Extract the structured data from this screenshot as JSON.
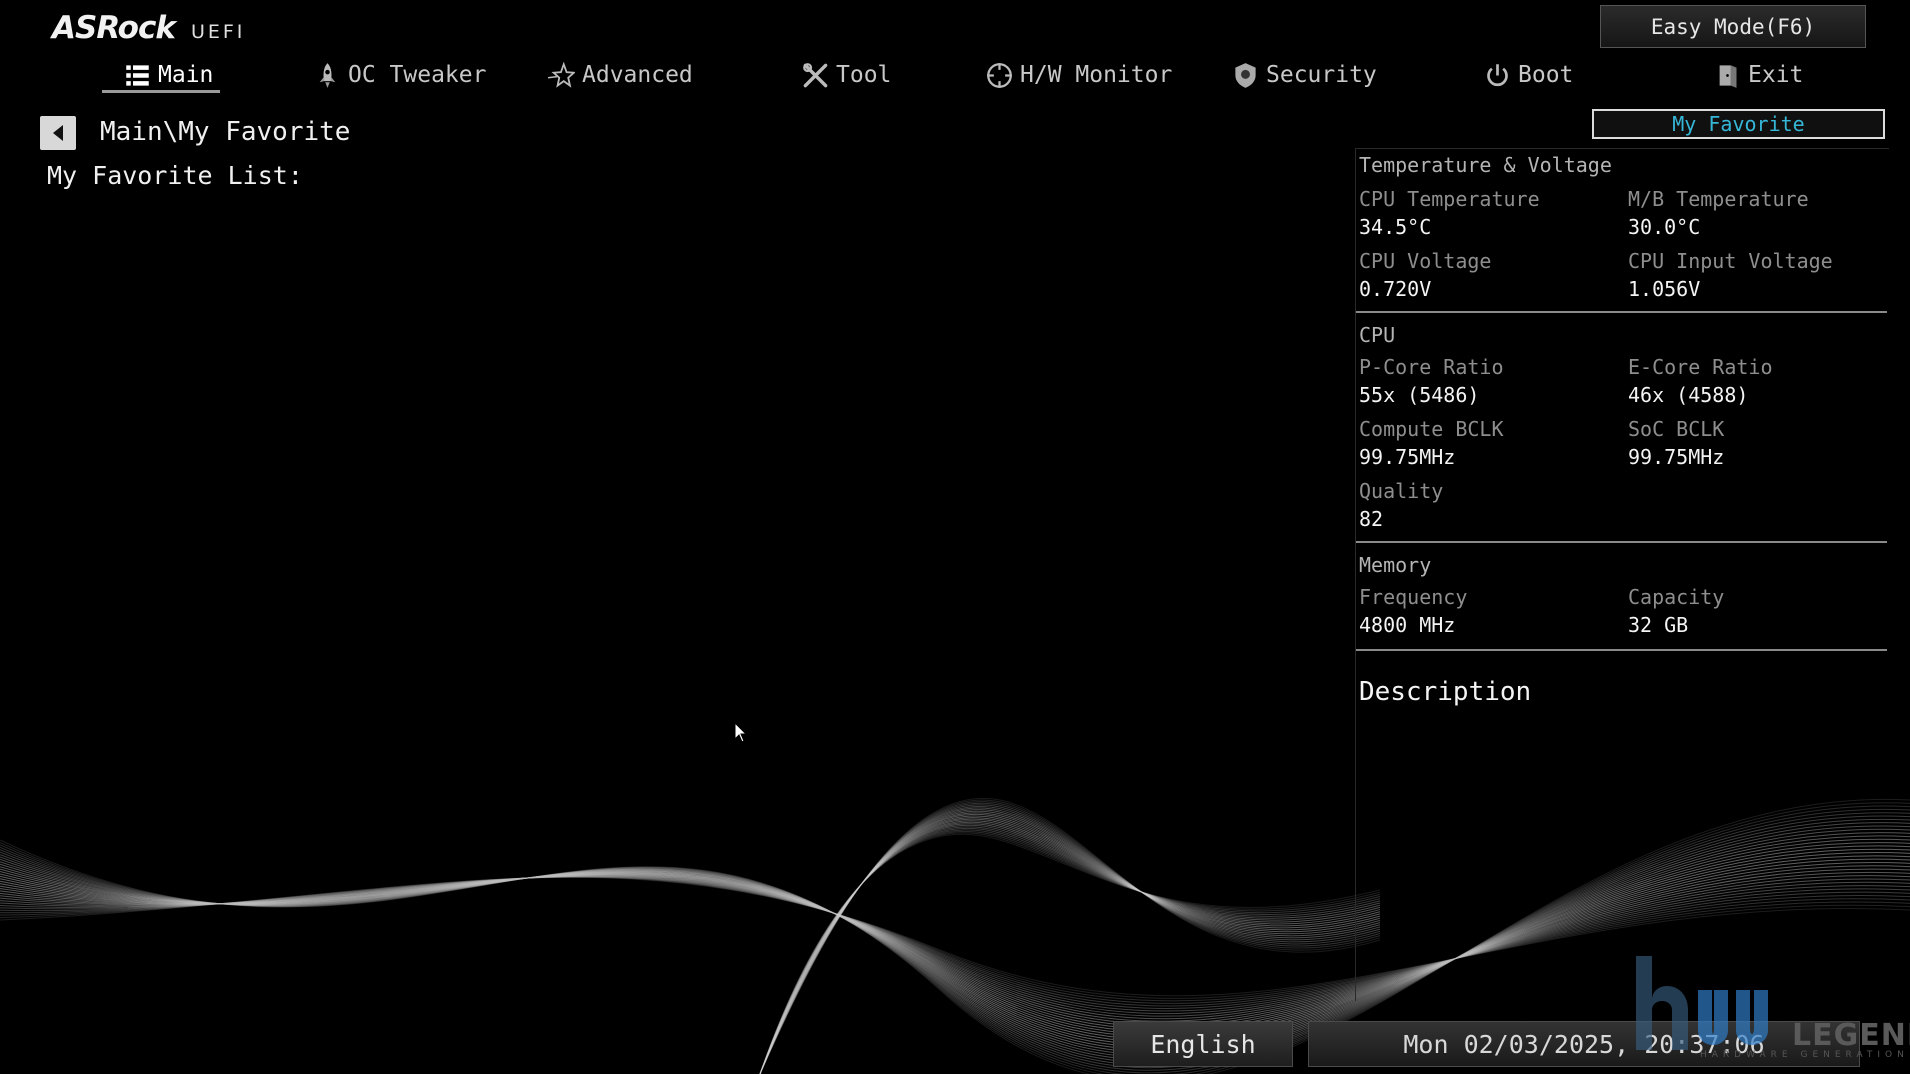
{
  "header": {
    "brand": "ASRock",
    "uefi": "UEFI",
    "easy_mode_label": "Easy Mode(F6)"
  },
  "tabs": [
    {
      "label": "Main",
      "icon": "list-icon",
      "active": true
    },
    {
      "label": "OC Tweaker",
      "icon": "rocket-icon"
    },
    {
      "label": "Advanced",
      "icon": "star-icon"
    },
    {
      "label": "Tool",
      "icon": "tools-icon"
    },
    {
      "label": "H/W Monitor",
      "icon": "crosshair-icon"
    },
    {
      "label": "Security",
      "icon": "shield-icon"
    },
    {
      "label": "Boot",
      "icon": "power-icon"
    },
    {
      "label": "Exit",
      "icon": "exit-door-icon"
    }
  ],
  "main": {
    "breadcrumb": "Main\\My Favorite",
    "list_label": "My Favorite List:"
  },
  "my_favorite_button": "My Favorite",
  "info_panel": {
    "temp_voltage": {
      "title": "Temperature & Voltage",
      "cpu_temp_label": "CPU Temperature",
      "cpu_temp_value": "34.5°C",
      "mb_temp_label": "M/B Temperature",
      "mb_temp_value": "30.0°C",
      "cpu_voltage_label": "CPU Voltage",
      "cpu_voltage_value": "0.720V",
      "cpu_input_voltage_label": "CPU Input Voltage",
      "cpu_input_voltage_value": "1.056V"
    },
    "cpu": {
      "title": "CPU",
      "pcore_label": "P-Core Ratio",
      "pcore_value": "55x (5486)",
      "ecore_label": "E-Core Ratio",
      "ecore_value": "46x (4588)",
      "compute_bclk_label": "Compute BCLK",
      "compute_bclk_value": "99.75MHz",
      "soc_bclk_label": "SoC BCLK",
      "soc_bclk_value": "99.75MHz",
      "quality_label": "Quality",
      "quality_value": "82"
    },
    "memory": {
      "title": "Memory",
      "frequency_label": "Frequency",
      "frequency_value": "4800 MHz",
      "capacity_label": "Capacity",
      "capacity_value": "32 GB"
    },
    "description_title": "Description"
  },
  "footer": {
    "language": "English",
    "datetime": "Mon 02/03/2025, 20:37:06"
  },
  "watermark": {
    "text": "LEGEND",
    "sub": "HARDWARE GENERATION"
  },
  "colors": {
    "background": "#000000",
    "accent": "#36b7d8",
    "text": "#f0f0f0",
    "muted_label": "#8e8e8e"
  }
}
